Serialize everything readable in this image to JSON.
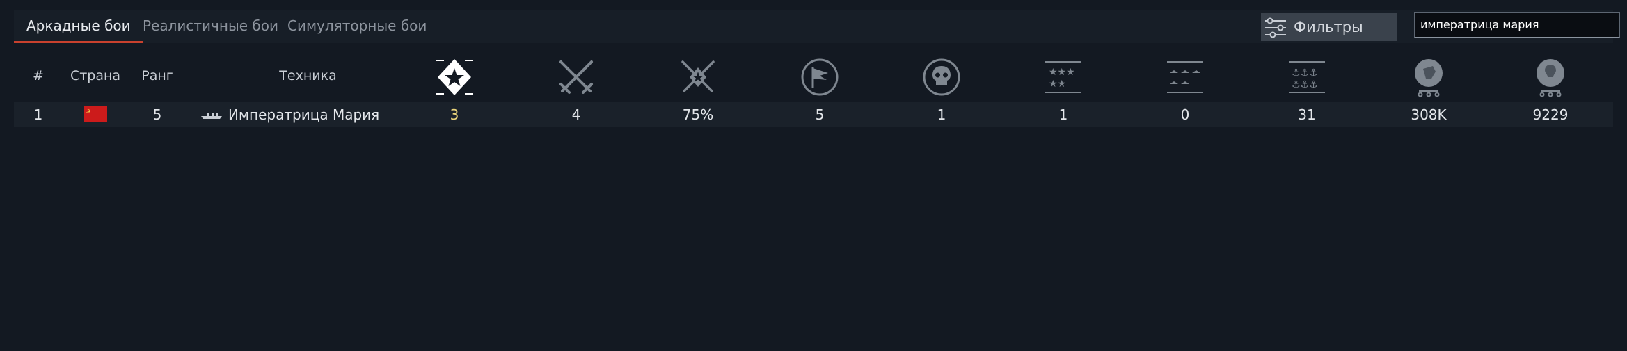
{
  "tabs": [
    {
      "label": "Аркадные бои",
      "active": true
    },
    {
      "label": "Реалистичные бои",
      "active": false
    },
    {
      "label": "Симуляторные бои",
      "active": false
    }
  ],
  "filters": {
    "label": "Фильтры",
    "icon": "sliders-icon"
  },
  "search": {
    "value": "императрица мария"
  },
  "columns": {
    "num": "#",
    "country": "Страна",
    "rank": "Ранг",
    "vehicle": "Техника"
  },
  "stat_icons": [
    "victory-icon",
    "crossed-swords-icon",
    "win-rate-icon",
    "flag-icon",
    "skull-icon",
    "stars-icon",
    "air-kills-icon",
    "naval-kills-icon",
    "lion-icon",
    "bulb-icon"
  ],
  "row": {
    "num": "1",
    "country_flag": "ussr-flag",
    "rank": "5",
    "vehicle": "Императрица Мария",
    "vehicle_icon": "ship-icon",
    "stats": [
      "3",
      "4",
      "75%",
      "5",
      "1",
      "1",
      "0",
      "31",
      "308K",
      "9229"
    ]
  },
  "colors": {
    "background": "#131922",
    "active_tab_underline": "#c8412e",
    "highlight_value": "#e9d37a"
  }
}
